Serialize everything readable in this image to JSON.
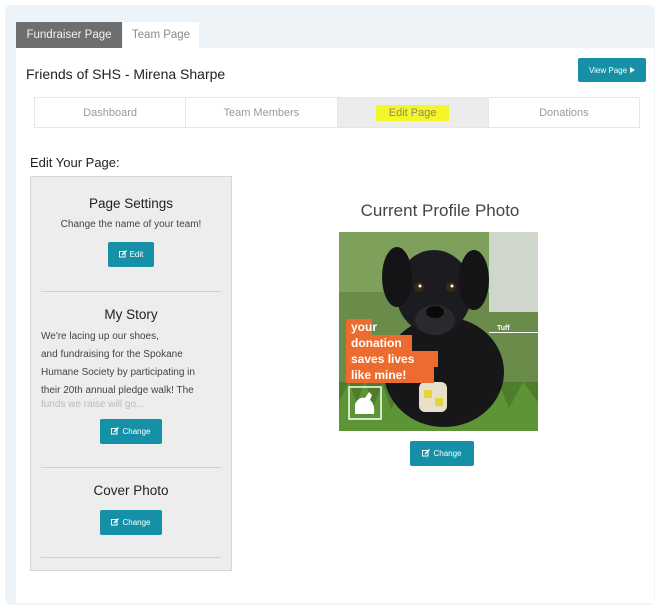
{
  "tabs": [
    {
      "label": "Fundraiser Page"
    },
    {
      "label": "Team Page"
    }
  ],
  "header": {
    "title": "Friends of SHS - Mirena Sharpe",
    "view_button": "View Page"
  },
  "subnav": [
    {
      "label": "Dashboard"
    },
    {
      "label": "Team Members"
    },
    {
      "label": "Edit Page"
    },
    {
      "label": "Donations"
    }
  ],
  "edit_heading": "Edit Your Page:",
  "sections": {
    "page_settings": {
      "title": "Page Settings",
      "subtitle": "Change the name of your team!",
      "button": "Edit"
    },
    "my_story": {
      "title": "My Story",
      "lines": [
        "We're lacing up our shoes,",
        "and fundraising for the Spokane",
        "Humane Society by participating in",
        "their 20th annual pledge walk! The",
        "funds we raise will go..."
      ],
      "button": "Change"
    },
    "cover_photo": {
      "title": "Cover Photo",
      "button": "Change"
    }
  },
  "profile_photo": {
    "title": "Current Profile Photo",
    "overlay_lines": [
      "your",
      "donation",
      "saves lives",
      "like mine!"
    ],
    "dog_name": "Tuff",
    "button": "Change"
  },
  "colors": {
    "accent": "#1590a6",
    "highlight": "#f4f52a",
    "overlay": "#ee6b2f",
    "active_tab": "#6e6e6e"
  },
  "icons": [
    "play-right-icon",
    "edit-icon",
    "dog-logo-icon"
  ]
}
